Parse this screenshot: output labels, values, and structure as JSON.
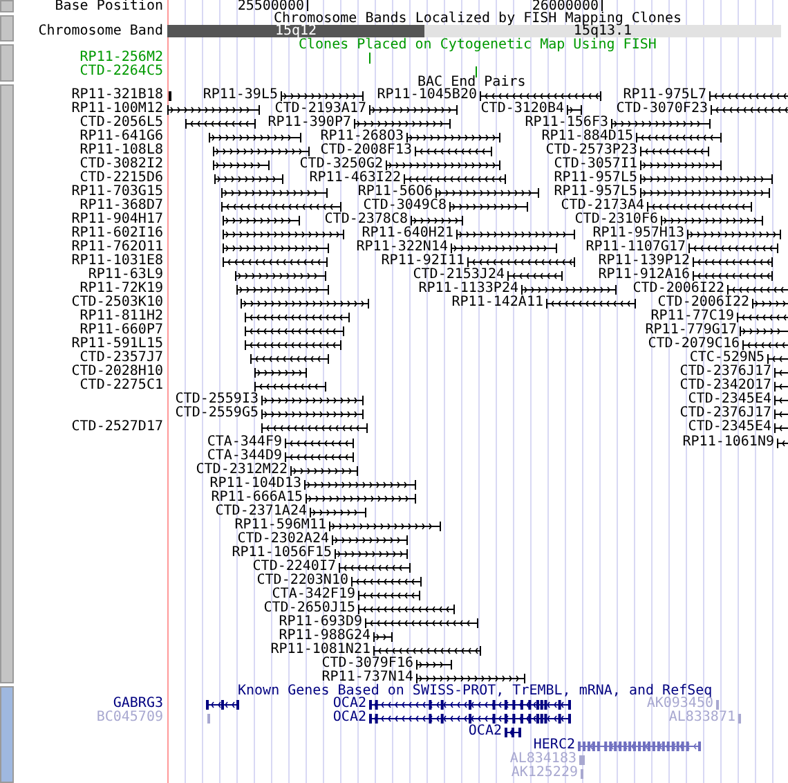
{
  "base_position": {
    "label": "Base Position",
    "ticks": [
      "25500000",
      "26000000"
    ]
  },
  "chromosome_bands": {
    "title": "Chromosome Bands Localized by FISH Mapping Clones",
    "label": "Chromosome Band",
    "bands": [
      {
        "name": "15q12",
        "kind": "dark"
      },
      {
        "name": "15q13.1",
        "kind": "light"
      }
    ]
  },
  "fish_clones": {
    "title": "Clones Placed on Cytogenetic Map Using FISH",
    "items": [
      {
        "name": "RP11-256M2"
      },
      {
        "name": "CTD-2264C5"
      }
    ]
  },
  "bac_end_pairs": {
    "title": "BAC End Pairs",
    "rows": [
      {
        "items": [
          {
            "name": "RP11-321B18"
          },
          {
            "name": "RP11-39L5",
            "reverse": false
          },
          {
            "name": "RP11-1045B20",
            "reverse": true
          },
          {
            "name": "RP11-975L7",
            "reverse": true
          }
        ]
      },
      {
        "items": [
          {
            "name": "RP11-100M12",
            "reverse": false
          },
          {
            "name": "CTD-2193A17",
            "reverse": false
          },
          {
            "name": "CTD-3120B4",
            "reverse": false
          },
          {
            "name": "CTD-3070F23",
            "reverse": true
          }
        ]
      },
      {
        "items": [
          {
            "name": "CTD-2056L5",
            "reverse": true
          },
          {
            "name": "RP11-390P7",
            "reverse": false
          },
          {
            "name": "RP11-156F3",
            "reverse": false
          }
        ]
      },
      {
        "items": [
          {
            "name": "RP11-641G6",
            "reverse": false
          },
          {
            "name": "RP11-268O3",
            "reverse": false
          },
          {
            "name": "RP11-884D15",
            "reverse": true
          }
        ]
      },
      {
        "items": [
          {
            "name": "RP11-108L8",
            "reverse": false
          },
          {
            "name": "CTD-2008F13",
            "reverse": true
          },
          {
            "name": "CTD-2573P23",
            "reverse": true
          }
        ]
      },
      {
        "items": [
          {
            "name": "CTD-3082I2",
            "reverse": false
          },
          {
            "name": "CTD-3250G2",
            "reverse": false
          },
          {
            "name": "CTD-3057I1",
            "reverse": false
          }
        ]
      },
      {
        "items": [
          {
            "name": "CTD-2215D6",
            "reverse": false
          },
          {
            "name": "RP11-463I22",
            "reverse": true
          },
          {
            "name": "RP11-957L5",
            "reverse": false
          }
        ]
      },
      {
        "items": [
          {
            "name": "RP11-703G15",
            "reverse": false
          },
          {
            "name": "RP11-56O6",
            "reverse": false
          },
          {
            "name": "RP11-957L5",
            "reverse": false
          }
        ]
      },
      {
        "items": [
          {
            "name": "RP11-368D7",
            "reverse": true
          },
          {
            "name": "CTD-3049C8",
            "reverse": false
          },
          {
            "name": "CTD-2173A4",
            "reverse": true
          }
        ]
      },
      {
        "items": [
          {
            "name": "RP11-904H17",
            "reverse": false
          },
          {
            "name": "CTD-2378C8",
            "reverse": false
          },
          {
            "name": "CTD-2310F6",
            "reverse": false
          }
        ]
      },
      {
        "items": [
          {
            "name": "RP11-602I16",
            "reverse": false
          },
          {
            "name": "RP11-640H21",
            "reverse": false
          },
          {
            "name": "RP11-957H13",
            "reverse": false
          }
        ]
      },
      {
        "items": [
          {
            "name": "RP11-762O11",
            "reverse": false
          },
          {
            "name": "RP11-322N14",
            "reverse": false
          },
          {
            "name": "RP11-1107G17",
            "reverse": true
          }
        ]
      },
      {
        "items": [
          {
            "name": "RP11-1031E8",
            "reverse": true
          },
          {
            "name": "RP11-92I11",
            "reverse": true
          },
          {
            "name": "RP11-139P12",
            "reverse": true
          }
        ]
      },
      {
        "items": [
          {
            "name": "RP11-63L9",
            "reverse": false
          },
          {
            "name": "CTD-2153J24",
            "reverse": true
          },
          {
            "name": "RP11-912A16",
            "reverse": true
          }
        ]
      },
      {
        "items": [
          {
            "name": "RP11-72K19",
            "reverse": false
          },
          {
            "name": "RP11-1133P24",
            "reverse": false
          },
          {
            "name": "CTD-2006I22",
            "reverse": true
          }
        ]
      },
      {
        "items": [
          {
            "name": "CTD-2503K10",
            "reverse": false
          },
          {
            "name": "RP11-142A11",
            "reverse": true
          },
          {
            "name": "CTD-2006I22",
            "reverse": false
          }
        ]
      },
      {
        "items": [
          {
            "name": "RP11-811H2",
            "reverse": true
          },
          {
            "name": "RP11-77C19",
            "reverse": true
          }
        ]
      },
      {
        "items": [
          {
            "name": "RP11-660P7",
            "reverse": true
          },
          {
            "name": "RP11-779G17",
            "reverse": false
          }
        ]
      },
      {
        "items": [
          {
            "name": "RP11-591L15",
            "reverse": true
          },
          {
            "name": "CTD-2079C16",
            "reverse": true
          }
        ]
      },
      {
        "items": [
          {
            "name": "CTD-2357J7",
            "reverse": true
          },
          {
            "name": "CTC-529N5",
            "reverse": true
          }
        ]
      },
      {
        "items": [
          {
            "name": "CTD-2028H10",
            "reverse": false
          },
          {
            "name": "CTD-2376J17",
            "reverse": true
          }
        ]
      },
      {
        "items": [
          {
            "name": "CTD-2275C1",
            "reverse": true
          },
          {
            "name": "CTD-2342O17",
            "reverse": true
          }
        ]
      },
      {
        "items": [
          {
            "name": "CTD-2559I3",
            "reverse": false
          },
          {
            "name": "CTD-2345E4",
            "reverse": true
          }
        ]
      },
      {
        "items": [
          {
            "name": "CTD-2559G5",
            "reverse": false
          },
          {
            "name": "CTD-2376J17",
            "reverse": true
          }
        ]
      },
      {
        "items": [
          {
            "name": "CTD-2527D17",
            "reverse": true
          },
          {
            "name": "CTD-2345E4",
            "reverse": true
          }
        ]
      },
      {
        "items": [
          {
            "name": "CTA-344F9",
            "reverse": true
          },
          {
            "name": "RP11-1061N9",
            "reverse": true
          }
        ]
      },
      {
        "items": [
          {
            "name": "CTA-344D9",
            "reverse": true
          }
        ]
      },
      {
        "items": [
          {
            "name": "CTD-2312M22",
            "reverse": false
          }
        ]
      },
      {
        "items": [
          {
            "name": "RP11-104D13",
            "reverse": false
          }
        ]
      },
      {
        "items": [
          {
            "name": "RP11-666A15",
            "reverse": false
          }
        ]
      },
      {
        "items": [
          {
            "name": "CTD-2371A24",
            "reverse": false
          }
        ]
      },
      {
        "items": [
          {
            "name": "RP11-596M11",
            "reverse": false
          }
        ]
      },
      {
        "items": [
          {
            "name": "CTD-2302A24",
            "reverse": false
          }
        ]
      },
      {
        "items": [
          {
            "name": "RP11-1056F15",
            "reverse": false
          }
        ]
      },
      {
        "items": [
          {
            "name": "CTD-2240I7",
            "reverse": true
          }
        ]
      },
      {
        "items": [
          {
            "name": "CTD-2203N10",
            "reverse": true
          }
        ]
      },
      {
        "items": [
          {
            "name": "CTA-342F19",
            "reverse": true
          }
        ]
      },
      {
        "items": [
          {
            "name": "CTD-2650J15",
            "reverse": true
          }
        ]
      },
      {
        "items": [
          {
            "name": "RP11-693D9",
            "reverse": true
          }
        ]
      },
      {
        "items": [
          {
            "name": "RP11-988G24",
            "reverse": false
          }
        ]
      },
      {
        "items": [
          {
            "name": "RP11-1081N21",
            "reverse": true
          }
        ]
      },
      {
        "items": [
          {
            "name": "CTD-3079F16",
            "reverse": false
          }
        ]
      },
      {
        "items": [
          {
            "name": "RP11-737N14",
            "reverse": false
          }
        ]
      }
    ]
  },
  "known_genes": {
    "title": "Known Genes Based on SWISS-PROT, TrEMBL, mRNA, and RefSeq",
    "rows": [
      {
        "items": [
          {
            "name": "GABRG3",
            "kind": "gene"
          },
          {
            "name": "OCA2",
            "kind": "gene"
          },
          {
            "name": "AK093450",
            "kind": "mrna"
          }
        ]
      },
      {
        "items": [
          {
            "name": "BC045709",
            "kind": "mrna"
          },
          {
            "name": "OCA2",
            "kind": "gene"
          },
          {
            "name": "AL833871",
            "kind": "mrna"
          }
        ]
      },
      {
        "items": [
          {
            "name": "OCA2",
            "kind": "gene"
          }
        ]
      },
      {
        "items": [
          {
            "name": "HERC2",
            "kind": "gene"
          }
        ]
      },
      {
        "items": [
          {
            "name": "AL834183",
            "kind": "mrna"
          }
        ]
      },
      {
        "items": [
          {
            "name": "AK125229",
            "kind": "mrna"
          }
        ]
      }
    ]
  }
}
